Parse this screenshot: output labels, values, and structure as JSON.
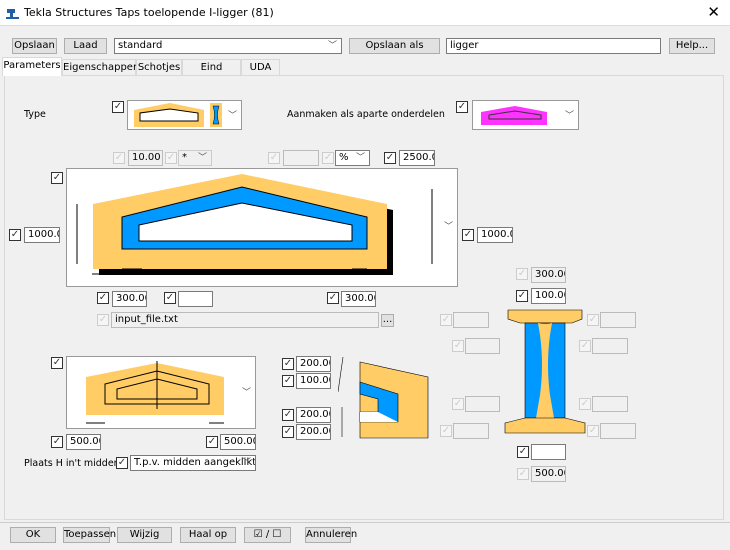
{
  "window": {
    "app": "Tekla Structures",
    "title": "Tekla Structures  Taps toelopende I-ligger (81)",
    "close": "✕"
  },
  "toolbar": {
    "save": "Opslaan",
    "load": "Laad",
    "preset": "standard",
    "save_as": "Opslaan als",
    "save_as_name": "ligger",
    "help": "Help..."
  },
  "tabs": [
    "Parameters",
    "Eigenschappen",
    "Schotjes",
    "Eind details",
    "UDA"
  ],
  "params": {
    "type_label": "Type",
    "separate_label": "Aanmaken als aparte onderdelen",
    "angle": "10.00",
    "angle_unit": "*",
    "slope": "",
    "slope_unit": "%",
    "length": "2500.00",
    "height_left": "1000.00",
    "height_right": "1000.00",
    "offset_left": "300.00",
    "offset_mid": "",
    "offset_right": "300.00",
    "file": "input_file.txt",
    "browse": "...",
    "chamfer_left": "500.00",
    "chamfer_right": "500.00",
    "place_h_label": "Plaats H in't midden",
    "place_h_value": "T.p.v. midden aangeklikte",
    "top_flange_1": "200.00",
    "top_flange_2": "100.00",
    "bottom_flange_1": "200.00",
    "bottom_flange_2": "200.00"
  },
  "section": {
    "top_width": "300.00",
    "top_web": "100.00",
    "left": [
      "",
      "",
      "",
      ""
    ],
    "right": [
      "",
      "",
      "",
      ""
    ],
    "bottom_web": "",
    "bottom_width": "500.00"
  },
  "footer": {
    "ok": "OK",
    "apply": "Toepassen",
    "modify": "Wijzig",
    "get": "Haal op",
    "toggle": "☑ / ☐",
    "cancel": "Annuleren"
  },
  "colors": {
    "concrete": "#ffcc66",
    "void": "#0099ff",
    "part": "#ff33ff"
  }
}
